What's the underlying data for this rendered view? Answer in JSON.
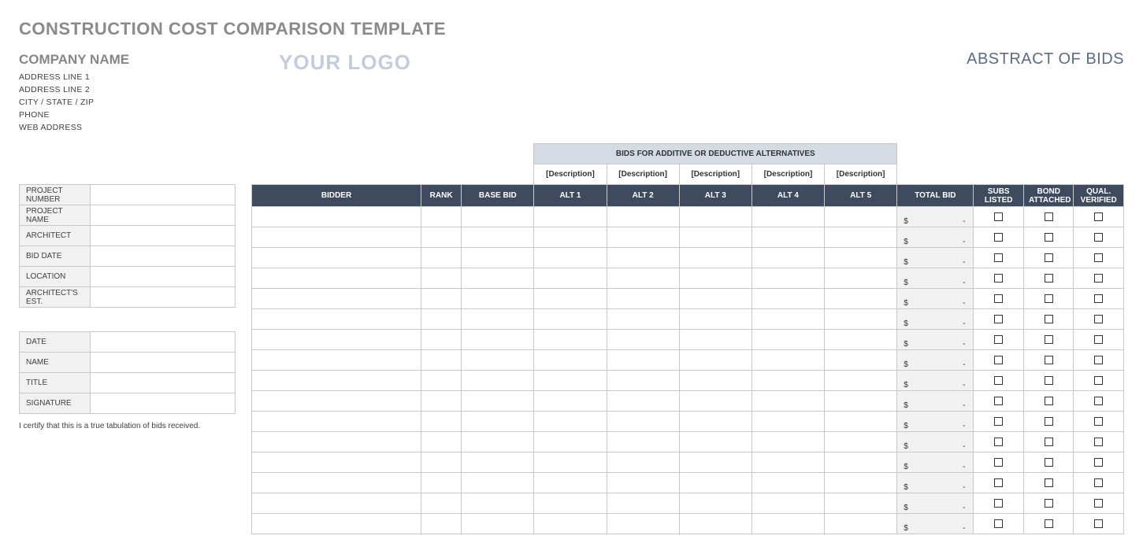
{
  "title": "CONSTRUCTION COST COMPARISON TEMPLATE",
  "company": {
    "name": "COMPANY NAME",
    "address1": "ADDRESS LINE 1",
    "address2": "ADDRESS LINE 2",
    "city_state_zip": "CITY / STATE / ZIP",
    "phone": "PHONE",
    "web": "WEB ADDRESS"
  },
  "logo_placeholder": "YOUR LOGO",
  "abstract_title": "ABSTRACT OF BIDS",
  "project_info_labels": {
    "project_number": "PROJECT NUMBER",
    "project_name": "PROJECT NAME",
    "architect": "ARCHITECT",
    "bid_date": "BID DATE",
    "location": "LOCATION",
    "architects_est": "ARCHITECT'S EST."
  },
  "project_info_values": {
    "project_number": "",
    "project_name": "",
    "architect": "",
    "bid_date": "",
    "location": "",
    "architects_est": ""
  },
  "sign_labels": {
    "date": "DATE",
    "name": "NAME",
    "title": "TITLE",
    "signature": "SIGNATURE"
  },
  "sign_values": {
    "date": "",
    "name": "",
    "title": "",
    "signature": ""
  },
  "certification": "I certify that this is a true tabulation of bids received.",
  "bids_alt_banner": "BIDS FOR ADDITIVE OR DEDUCTIVE ALTERNATIVES",
  "alt_descriptions": [
    "[Description]",
    "[Description]",
    "[Description]",
    "[Description]",
    "[Description]"
  ],
  "headers": {
    "bidder": "BIDDER",
    "rank": "RANK",
    "base_bid": "BASE BID",
    "alts": [
      "ALT 1",
      "ALT 2",
      "ALT 3",
      "ALT 4",
      "ALT 5"
    ],
    "total_bid": "TOTAL BID",
    "subs_listed": "SUBS LISTED",
    "bond_attached": "BOND ATTACHED",
    "qual_verified": "QUAL. VERIFIED"
  },
  "row_count": 16,
  "total_bid_display": {
    "currency": "$",
    "dash": "-"
  }
}
